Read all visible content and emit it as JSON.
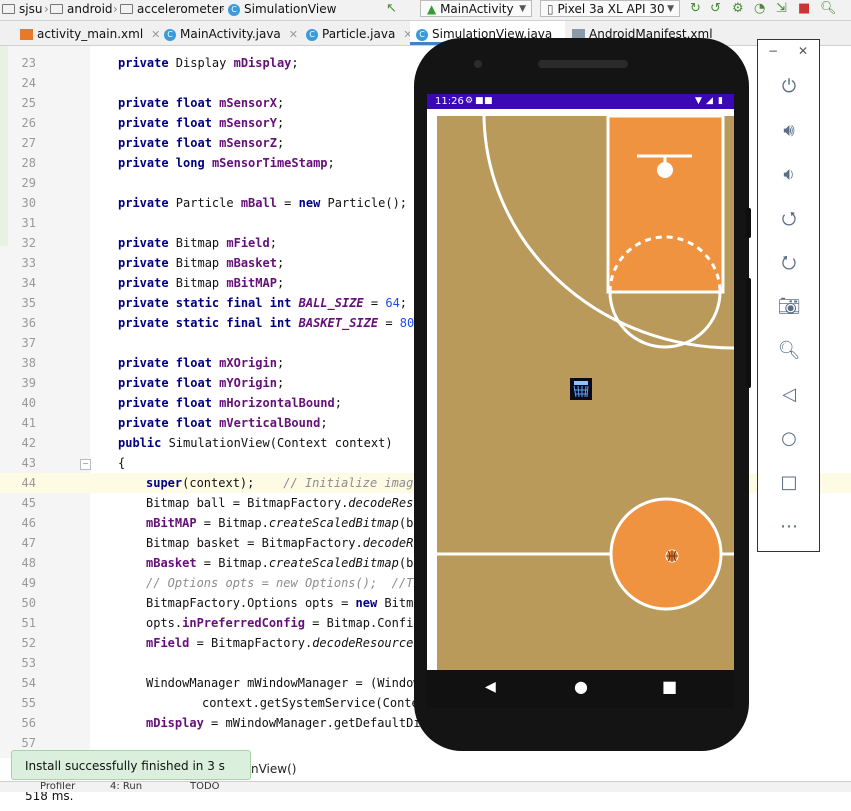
{
  "nav": {
    "crumbs": [
      "sjsu",
      "android",
      "accelerometer",
      "SimulationView"
    ],
    "run_config": "MainActivity",
    "device": "Pixel 3a XL API 30"
  },
  "tabs": [
    {
      "label": "activity_main.xml",
      "type": "xml"
    },
    {
      "label": "MainActivity.java",
      "type": "java"
    },
    {
      "label": "Particle.java",
      "type": "java"
    },
    {
      "label": "SimulationView.java",
      "type": "java",
      "active": true
    },
    {
      "label": "AndroidManifest.xml",
      "type": "manifest"
    }
  ],
  "code_lines": [
    {
      "n": "23",
      "indent": 1,
      "html": "<span class='k'>private</span> Display <span class='f'>mDisplay</span>;"
    },
    {
      "n": "24",
      "indent": 0,
      "html": ""
    },
    {
      "n": "25",
      "indent": 1,
      "html": "<span class='k'>private float</span> <span class='f'>mSensorX</span>;"
    },
    {
      "n": "26",
      "indent": 1,
      "html": "<span class='k'>private float</span> <span class='f'>mSensorY</span>;"
    },
    {
      "n": "27",
      "indent": 1,
      "html": "<span class='k'>private float</span> <span class='f'>mSensorZ</span>;"
    },
    {
      "n": "28",
      "indent": 1,
      "html": "<span class='k'>private long</span> <span class='f'>mSensorTimeStamp</span>;"
    },
    {
      "n": "29",
      "indent": 0,
      "html": ""
    },
    {
      "n": "30",
      "indent": 1,
      "html": "<span class='k'>private</span> Particle <span class='f'>mBall</span> = <span class='k'>new</span> Particle();"
    },
    {
      "n": "31",
      "indent": 0,
      "html": ""
    },
    {
      "n": "32",
      "indent": 1,
      "html": "<span class='k'>private</span> Bitmap <span class='f'>mField</span>;"
    },
    {
      "n": "33",
      "indent": 1,
      "html": "<span class='k'>private</span> Bitmap <span class='f'>mBasket</span>;"
    },
    {
      "n": "34",
      "indent": 1,
      "html": "<span class='k'>private</span> Bitmap <span class='f'>mBitMAP</span>;"
    },
    {
      "n": "35",
      "indent": 1,
      "html": "<span class='k'>private static final int</span> <span class='fi'>BALL_SIZE</span> = <span class='n'>64</span>;"
    },
    {
      "n": "36",
      "indent": 1,
      "html": "<span class='k'>private static final int</span> <span class='fi'>BASKET_SIZE</span> = <span class='n'>80</span>;"
    },
    {
      "n": "37",
      "indent": 0,
      "html": ""
    },
    {
      "n": "38",
      "indent": 1,
      "html": "<span class='k'>private float</span> <span class='f'>mXOrigin</span>;"
    },
    {
      "n": "39",
      "indent": 1,
      "html": "<span class='k'>private float</span> <span class='f'>mYOrigin</span>;"
    },
    {
      "n": "40",
      "indent": 1,
      "html": "<span class='k'>private float</span> <span class='f'>mHorizontalBound</span>;"
    },
    {
      "n": "41",
      "indent": 1,
      "html": "<span class='k'>private float</span> <span class='f'>mVerticalBound</span>;"
    },
    {
      "n": "42",
      "indent": 1,
      "html": "<span class='k'>public</span> SimulationView(Context context)"
    },
    {
      "n": "43",
      "indent": 1,
      "html": "{"
    },
    {
      "n": "44",
      "indent": 2,
      "html": "<span class='k'>super</span>(context);    <span class='cm'>// Initialize image</span>",
      "current": true
    },
    {
      "n": "45",
      "indent": 2,
      "html": "Bitmap ball = BitmapFactory.<span class='i'>decodeReso</span>"
    },
    {
      "n": "46",
      "indent": 2,
      "html": "<span class='f'>mBitMAP</span> = Bitmap.<span class='i'>createScaledBitmap</span>(ba"
    },
    {
      "n": "47",
      "indent": 2,
      "html": "Bitmap basket = BitmapFactory.<span class='i'>decodeRe</span>"
    },
    {
      "n": "48",
      "indent": 2,
      "html": "<span class='f'>mBasket</span> = Bitmap.<span class='i'>createScaledBitmap</span>(ba"
    },
    {
      "n": "49",
      "indent": 2,
      "html": "<span class='cm'>// Options opts = new Options();  //Th</span>"
    },
    {
      "n": "50",
      "indent": 2,
      "html": "BitmapFactory.Options opts = <span class='k'>new</span> Bitma"
    },
    {
      "n": "51",
      "indent": 2,
      "html": "opts.<span class='f'>inPreferredConfig</span> = Bitmap.Config"
    },
    {
      "n": "52",
      "indent": 2,
      "html": "<span class='f'>mField</span> = BitmapFactory.<span class='i'>decodeResource</span>("
    },
    {
      "n": "53",
      "indent": 0,
      "html": ""
    },
    {
      "n": "54",
      "indent": 2,
      "html": "WindowManager mWindowManager = (Window"
    },
    {
      "n": "55",
      "indent": 4,
      "html": "context.getSystemService(Conte"
    },
    {
      "n": "56",
      "indent": 2,
      "html": "<span class='f'>mDisplay</span> = mWindowManager.getDefaultDi"
    },
    {
      "n": "57",
      "indent": 0,
      "html": ""
    }
  ],
  "phone": {
    "time": "11:26"
  },
  "toast": {
    "message": "Install successfully finished in 3 s 518 ms."
  },
  "breadcrumb_bottom": "nView()",
  "bottom_bar": {
    "items": [
      "Profiler",
      "4: Run",
      "TODO"
    ]
  },
  "emulator_tools": [
    "power",
    "volume-up",
    "volume-down",
    "rotate-left",
    "rotate-right",
    "screenshot",
    "zoom",
    "back",
    "home",
    "overview",
    "more"
  ],
  "colors": {
    "court": "#b99a5b",
    "paint": "#ef9340",
    "status_bar": "#3a09b5",
    "accent": "#4083c9"
  }
}
